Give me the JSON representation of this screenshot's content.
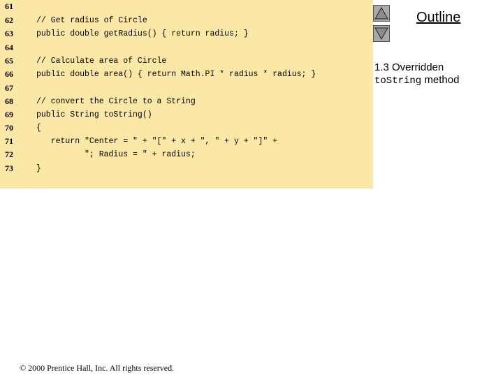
{
  "code_lines": [
    {
      "num": "61",
      "text": ""
    },
    {
      "num": "62",
      "text": "// Get radius of Circle"
    },
    {
      "num": "63",
      "text": "public double getRadius() { return radius; }"
    },
    {
      "num": "64",
      "text": ""
    },
    {
      "num": "65",
      "text": "// Calculate area of Circle"
    },
    {
      "num": "66",
      "text": "public double area() { return Math.PI * radius * radius; }"
    },
    {
      "num": "67",
      "text": ""
    },
    {
      "num": "68",
      "text": "// convert the Circle to a String"
    },
    {
      "num": "69",
      "text": "public String toString()"
    },
    {
      "num": "70",
      "text": "{"
    },
    {
      "num": "71",
      "text": "   return \"Center = \" + \"[\" + x + \", \" + y + \"]\" +"
    },
    {
      "num": "72",
      "text": "          \"; Radius = \" + radius;"
    },
    {
      "num": "73",
      "text": "}"
    }
  ],
  "outline": {
    "title": "Outline",
    "note_prefix": "1.3 Overridden",
    "note_code": "toString",
    "note_suffix": " method"
  },
  "footer": {
    "copyright": "© 2000 Prentice Hall, Inc.  All rights reserved."
  },
  "colors": {
    "code_background": "#fbe7a6",
    "button_gray": "#a9a9a9"
  },
  "icons": {
    "prev": "triangle-up-icon",
    "next": "triangle-down-icon"
  }
}
